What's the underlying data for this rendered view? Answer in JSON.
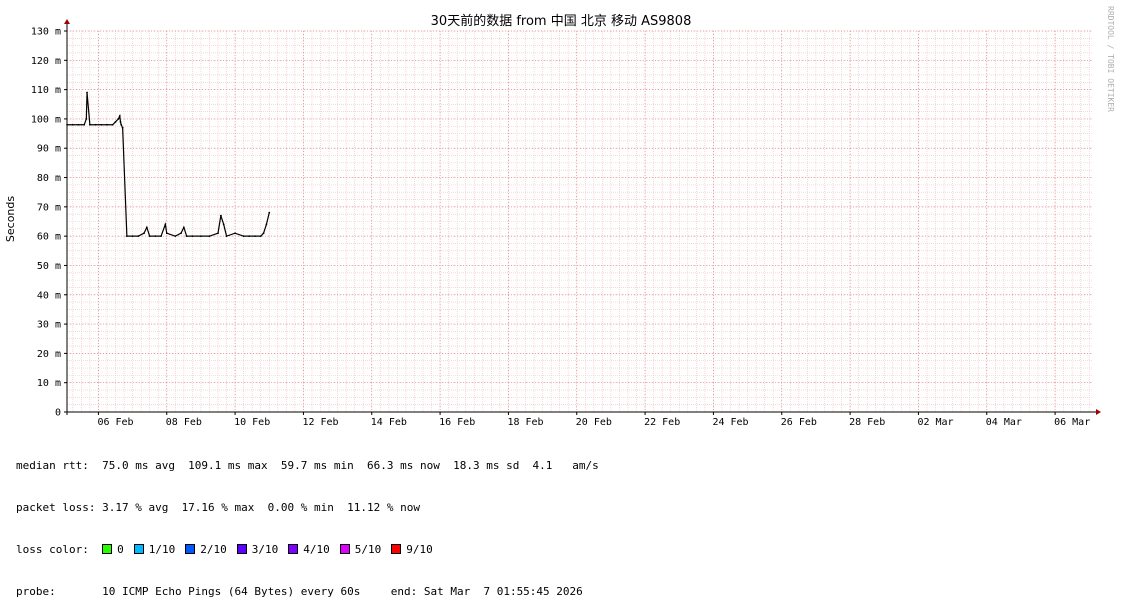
{
  "chart_data": {
    "type": "line",
    "title": "30天前的数据 from  中国 北京 移动 AS9808",
    "ylabel": "Seconds",
    "ylim": [
      0,
      0.13
    ],
    "yticks": [
      {
        "value": 0,
        "label": "0"
      },
      {
        "value": 0.01,
        "label": "10 m"
      },
      {
        "value": 0.02,
        "label": "20 m"
      },
      {
        "value": 0.03,
        "label": "30 m"
      },
      {
        "value": 0.04,
        "label": "40 m"
      },
      {
        "value": 0.05,
        "label": "50 m"
      },
      {
        "value": 0.06,
        "label": "60 m"
      },
      {
        "value": 0.07,
        "label": "70 m"
      },
      {
        "value": 0.08,
        "label": "80 m"
      },
      {
        "value": 0.09,
        "label": "90 m"
      },
      {
        "value": 0.1,
        "label": "100 m"
      },
      {
        "value": 0.11,
        "label": "110 m"
      },
      {
        "value": 0.12,
        "label": "120 m"
      },
      {
        "value": 0.13,
        "label": "130 m"
      }
    ],
    "xlim": [
      "2026-02-05T01:55:45",
      "2026-03-07T01:55:45"
    ],
    "xticks": [
      {
        "value": "2026-02-06",
        "label": "06 Feb"
      },
      {
        "value": "2026-02-08",
        "label": "08 Feb"
      },
      {
        "value": "2026-02-10",
        "label": "10 Feb"
      },
      {
        "value": "2026-02-12",
        "label": "12 Feb"
      },
      {
        "value": "2026-02-14",
        "label": "14 Feb"
      },
      {
        "value": "2026-02-16",
        "label": "16 Feb"
      },
      {
        "value": "2026-02-18",
        "label": "18 Feb"
      },
      {
        "value": "2026-02-20",
        "label": "20 Feb"
      },
      {
        "value": "2026-02-22",
        "label": "22 Feb"
      },
      {
        "value": "2026-02-24",
        "label": "24 Feb"
      },
      {
        "value": "2026-02-26",
        "label": "26 Feb"
      },
      {
        "value": "2026-02-28",
        "label": "28 Feb"
      },
      {
        "value": "2026-03-02",
        "label": "02 Mar"
      },
      {
        "value": "2026-03-04",
        "label": "04 Mar"
      },
      {
        "value": "2026-03-06",
        "label": "06 Mar"
      }
    ],
    "grid": true,
    "series": [
      {
        "color": "#000000",
        "x": [
          "2026-02-05T02:00",
          "2026-02-05T06:00",
          "2026-02-05T10:00",
          "2026-02-05T14:00",
          "2026-02-05T15:30",
          "2026-02-05T16:00",
          "2026-02-05T18:00",
          "2026-02-05T22:00",
          "2026-02-06T02:00",
          "2026-02-06T06:00",
          "2026-02-06T10:00",
          "2026-02-06T12:00",
          "2026-02-06T14:00",
          "2026-02-06T15:00",
          "2026-02-06T15:30",
          "2026-02-06T16:00",
          "2026-02-06T17:00",
          "2026-02-06T20:00",
          "2026-02-07T00:00",
          "2026-02-07T04:00",
          "2026-02-07T08:00",
          "2026-02-07T10:00",
          "2026-02-07T12:00",
          "2026-02-07T16:00",
          "2026-02-07T20:00",
          "2026-02-07T23:00",
          "2026-02-08T00:00",
          "2026-02-08T06:00",
          "2026-02-08T10:00",
          "2026-02-08T12:00",
          "2026-02-08T14:00",
          "2026-02-08T18:00",
          "2026-02-09T00:00",
          "2026-02-09T06:00",
          "2026-02-09T12:00",
          "2026-02-09T14:00",
          "2026-02-09T16:00",
          "2026-02-09T18:00",
          "2026-02-10T00:00",
          "2026-02-10T06:00",
          "2026-02-10T10:00",
          "2026-02-10T14:00",
          "2026-02-10T18:00",
          "2026-02-10T20:00",
          "2026-02-10T22:00",
          "2026-02-11T00:00"
        ],
        "y": [
          0.098,
          0.098,
          0.098,
          0.098,
          0.1,
          0.109,
          0.098,
          0.098,
          0.098,
          0.098,
          0.098,
          0.099,
          0.1,
          0.101,
          0.099,
          0.098,
          0.097,
          0.06,
          0.06,
          0.06,
          0.061,
          0.063,
          0.06,
          0.06,
          0.06,
          0.064,
          0.061,
          0.06,
          0.061,
          0.063,
          0.06,
          0.06,
          0.06,
          0.06,
          0.061,
          0.067,
          0.064,
          0.06,
          0.061,
          0.06,
          0.06,
          0.06,
          0.06,
          0.061,
          0.064,
          0.068
        ]
      }
    ]
  },
  "watermark": "RRDTOOL / TOBI OETIKER",
  "stats": {
    "rtt_line": "median rtt:  75.0 ms avg  109.1 ms max  59.7 ms min  66.3 ms now  18.3 ms sd  4.1   am/s",
    "loss_line": "packet loss: 3.17 % avg  17.16 % max  0.00 % min  11.12 % now",
    "loss_color_label": "loss color:  ",
    "loss_colors": [
      {
        "label": "0",
        "color": "#26ff00"
      },
      {
        "label": "1/10",
        "color": "#00b8ff"
      },
      {
        "label": "2/10",
        "color": "#0059ff"
      },
      {
        "label": "3/10",
        "color": "#5e00ff"
      },
      {
        "label": "4/10",
        "color": "#7e00ff"
      },
      {
        "label": "5/10",
        "color": "#dd00ff"
      },
      {
        "label": "9/10",
        "color": "#ff0000"
      }
    ],
    "probe_line": "probe:       10 ICMP Echo Pings (64 Bytes) every 60s",
    "end_line": "end: Sat Mar  7 01:55:45 2026"
  }
}
